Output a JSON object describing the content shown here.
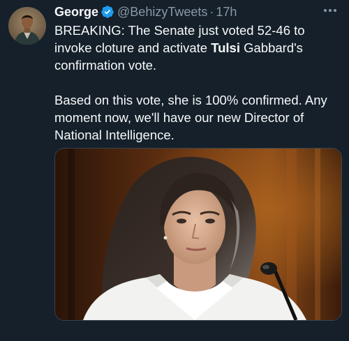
{
  "author": {
    "name": "George",
    "handle": "@BehizyTweets",
    "separator": "·",
    "time": "17h"
  },
  "tweet": {
    "line1_before": "BREAKING: The Senate just voted 52-46 to invoke cloture and activate ",
    "line1_bold": "Tulsi",
    "line1_after": " Gabbard's confirmation vote.",
    "paragraph2": "Based on this vote, she is 100% confirmed. Any moment now, we'll have our new Director of National Intelligence."
  },
  "icons": {
    "verified": "verified-badge-icon",
    "more": "more-options-icon"
  },
  "colors": {
    "background": "#15202b",
    "text": "#f7f9f9",
    "secondary": "#8b98a5",
    "verified": "#1d9bf0"
  }
}
